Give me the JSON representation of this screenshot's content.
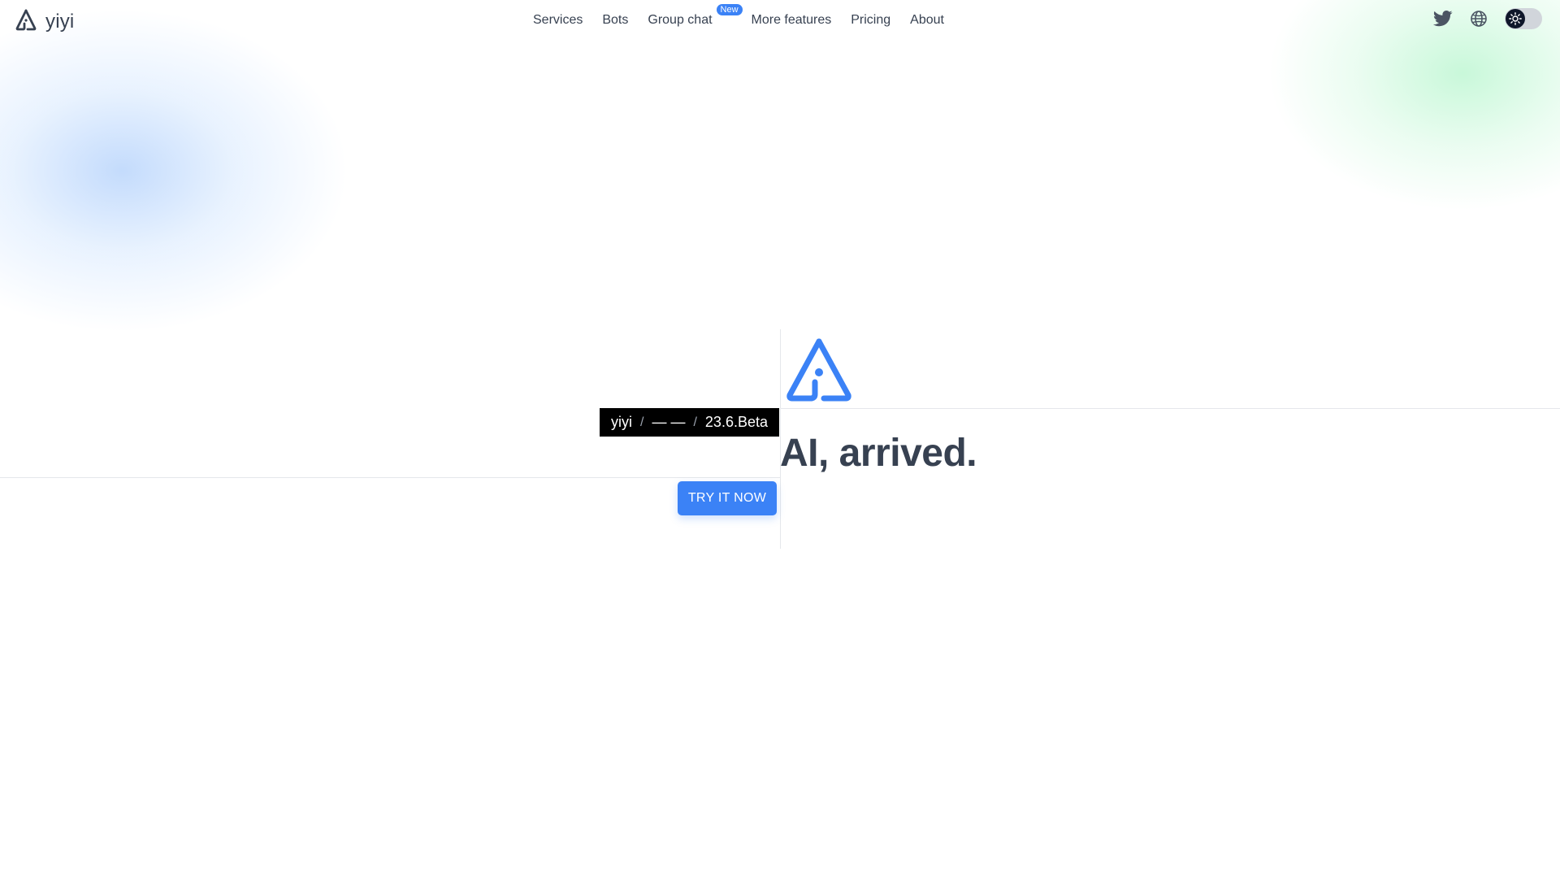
{
  "brand": {
    "name": "yiyi",
    "logo_icon": "yiyi-logo-icon"
  },
  "nav": {
    "items": [
      {
        "label": "Services"
      },
      {
        "label": "Bots"
      },
      {
        "label": "Group chat",
        "badge": "New"
      },
      {
        "label": "More features"
      },
      {
        "label": "Pricing"
      },
      {
        "label": "About"
      }
    ]
  },
  "header_actions": {
    "twitter_icon": "twitter-icon",
    "language_icon": "globe-icon",
    "theme_toggle_icon": "sun-icon"
  },
  "hero": {
    "version": {
      "name": "yiyi",
      "separator": "/",
      "middle": "— —",
      "release": "23.6.Beta"
    },
    "headline": "AI, arrived.",
    "cta_label": "TRY IT NOW"
  },
  "colors": {
    "accent": "#3b82f6",
    "text": "#374151",
    "version_bar_bg": "#000000",
    "toggle_knob": "#0f172a"
  }
}
